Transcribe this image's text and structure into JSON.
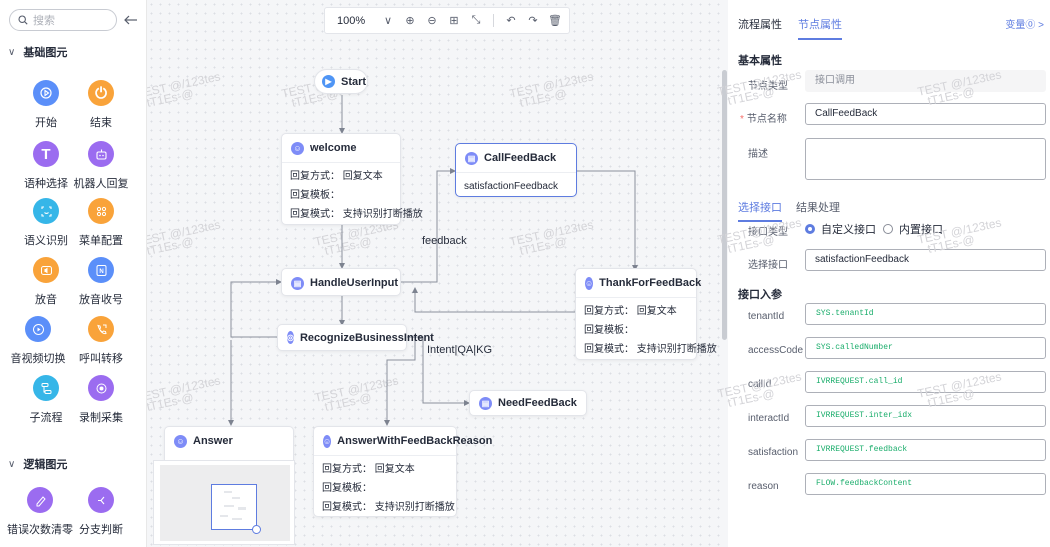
{
  "palette": {
    "search_placeholder": "搜索",
    "group_basic": "基础图元",
    "group_logic": "逻辑图元",
    "basic_items": [
      {
        "label": "开始",
        "icon": "play-icon"
      },
      {
        "label": "结束",
        "icon": "power-icon"
      },
      {
        "label": "语种选择",
        "icon": "text-icon"
      },
      {
        "label": "机器人回复",
        "icon": "robot-icon"
      },
      {
        "label": "语义识别",
        "icon": "scan-icon"
      },
      {
        "label": "菜单配置",
        "icon": "menu-icon"
      },
      {
        "label": "放音",
        "icon": "speaker-icon"
      },
      {
        "label": "放音收号",
        "icon": "keypad-icon"
      },
      {
        "label": "音视频切换",
        "icon": "media-switch-icon"
      },
      {
        "label": "呼叫转移",
        "icon": "call-transfer-icon"
      },
      {
        "label": "子流程",
        "icon": "subflow-icon"
      },
      {
        "label": "录制采集",
        "icon": "record-icon"
      }
    ],
    "logic_items": [
      {
        "label": "错误次数清零",
        "icon": "clear-icon"
      },
      {
        "label": "分支判断",
        "icon": "branch-icon"
      }
    ]
  },
  "toolbar": {
    "zoom": "100%"
  },
  "nodes": {
    "start": {
      "title": "Start"
    },
    "welcome": {
      "title": "welcome",
      "rows": [
        "回复方式：  回复文本",
        "回复模板：",
        "回复模式：  支持识别打断播放"
      ]
    },
    "callfeedback": {
      "title": "CallFeedBack",
      "rows": [
        "satisfactionFeedback"
      ]
    },
    "handleuserinput": {
      "title": "HandleUserInput"
    },
    "thankforfeedback": {
      "title": "ThankForFeedBack",
      "rows": [
        "回复方式：  回复文本",
        "回复模板：",
        "回复模式：  支持识别打断播放"
      ]
    },
    "recognize": {
      "title": "RecognizeBusinessIntent"
    },
    "needfeedback": {
      "title": "NeedFeedBack"
    },
    "answer": {
      "title": "Answer"
    },
    "answerwithfeedback": {
      "title": "AnswerWithFeedBackReason",
      "rows": [
        "回复方式：  回复文本",
        "回复模板：",
        "回复模式：  支持识别打断播放"
      ]
    }
  },
  "edge_labels": {
    "feedback": "feedback",
    "intent": "Intent|QA|KG"
  },
  "watermark": {
    "line1": "TEST @/123tes",
    "line2": "tT1Es-@"
  },
  "panel": {
    "tab_flow": "流程属性",
    "tab_node": "节点属性",
    "variables_link": "变量⓪  >",
    "section_basic": "基本属性",
    "node_type_label": "节点类型",
    "node_type_value": "接口调用",
    "node_name_label": "节点名称",
    "node_name_value": "CallFeedBack",
    "desc_label": "描述",
    "subtab_interface": "选择接口",
    "subtab_result": "结果处理",
    "interface_type_label": "接口类型",
    "radio_custom": "自定义接口",
    "radio_builtin": "内置接口",
    "select_interface_label": "选择接口",
    "select_interface_value": "satisfactionFeedback",
    "section_params": "接口入参",
    "params": [
      {
        "name": "tenantId",
        "value": "SYS.tenantId"
      },
      {
        "name": "accessCode",
        "value": "SYS.calledNumber"
      },
      {
        "name": "callId",
        "value": "IVRREQUEST.call_id"
      },
      {
        "name": "interactId",
        "value": "IVRREQUEST.inter_idx"
      },
      {
        "name": "satisfaction",
        "value": "IVRREQUEST.feedback"
      },
      {
        "name": "reason",
        "value": "FLOW.feedbackContent"
      }
    ]
  },
  "colors": {
    "accent": "#5e7ce0",
    "param_value": "#1aad6b"
  }
}
